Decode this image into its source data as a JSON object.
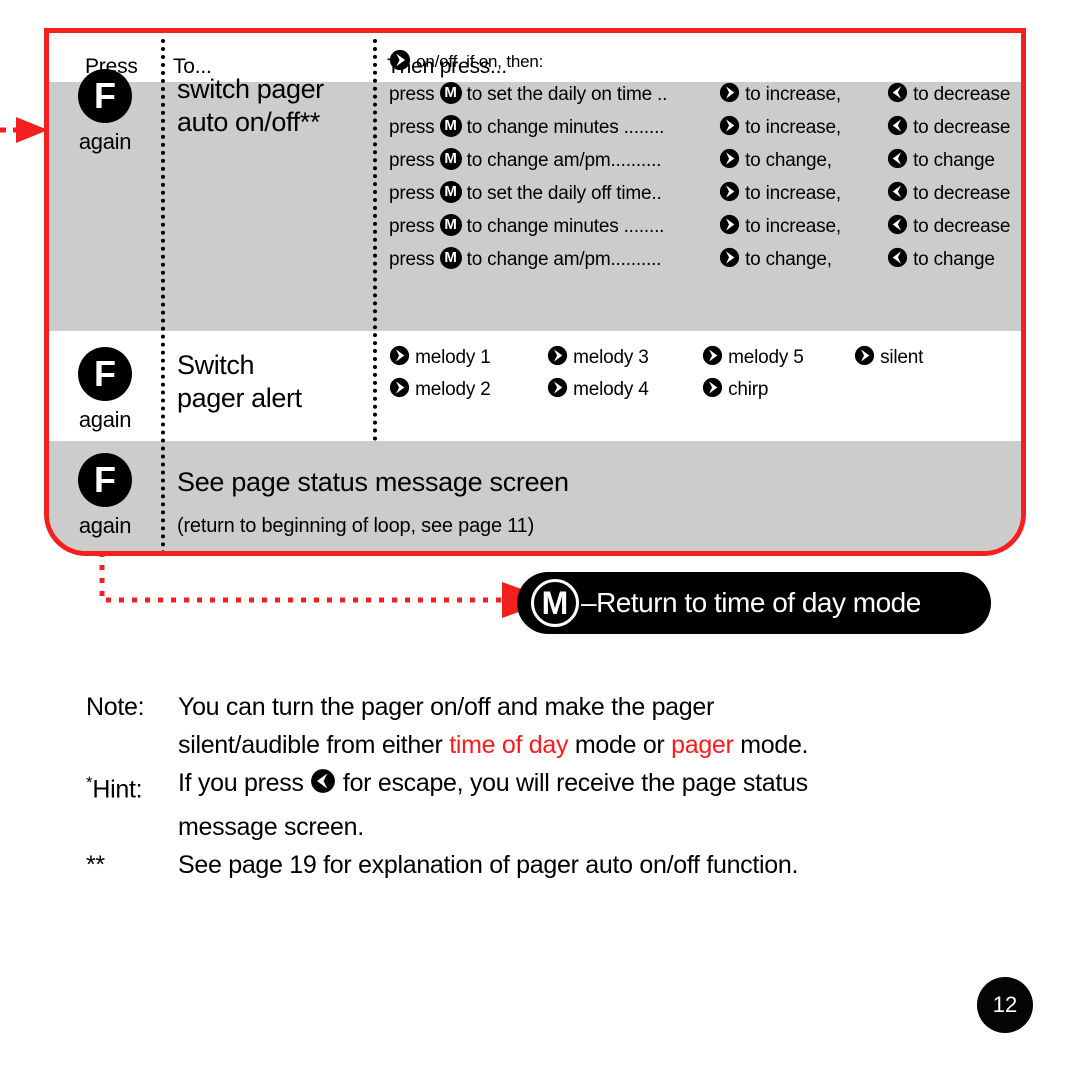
{
  "table": {
    "headers": {
      "press": "Press",
      "to": "To...",
      "then": "Then press..."
    },
    "rows": [
      {
        "press_key": "F",
        "press_sub": "again",
        "to_line1": "switch pager",
        "to_line2": "auto on/off**",
        "then_first": "on/off, if on, then:",
        "then_lines": [
          {
            "press": "press",
            "action": "to set the daily on time ..",
            "inc": "to increase,",
            "dec": "to decrease"
          },
          {
            "press": "press",
            "action": "to change minutes ........",
            "inc": "to increase,",
            "dec": "to decrease"
          },
          {
            "press": "press",
            "action": "to change am/pm..........",
            "inc": "to change,",
            "dec": "to change"
          },
          {
            "press": "press",
            "action": "to set the daily off time..",
            "inc": "to increase,",
            "dec": "to decrease"
          },
          {
            "press": "press",
            "action": "to change minutes ........",
            "inc": "to increase,",
            "dec": "to decrease"
          },
          {
            "press": "press",
            "action": "to change am/pm..........",
            "inc": "to change,",
            "dec": "to change"
          }
        ]
      },
      {
        "press_key": "F",
        "press_sub": "again",
        "to_line1": "Switch",
        "to_line2": "pager alert",
        "melodies": [
          [
            "melody 1",
            "melody 3",
            "melody 5",
            "silent"
          ],
          [
            "melody 2",
            "melody 4",
            "chirp",
            ""
          ]
        ]
      },
      {
        "press_key": "F",
        "press_sub": "again",
        "title": "See page status message screen",
        "subtitle": "(return to beginning of loop, see page 11)"
      }
    ]
  },
  "mode_pill": {
    "key": "M",
    "dash": "–",
    "text": "Return to time of day mode"
  },
  "notes": [
    {
      "label": "Note:",
      "line1": "You can turn the pager on/off and make the pager",
      "line2_a": "silent/audible from either ",
      "line2_red1": "time of day",
      "line2_b": " mode or ",
      "line2_red2": "pager",
      "line2_c": " mode."
    },
    {
      "label_sup": "*",
      "label": "Hint:",
      "line1_a": "If you press ",
      "line1_b": " for escape, you will receive the page status",
      "line2": "message screen."
    },
    {
      "label": "**",
      "line1": "See page 19 for explanation of pager auto on/off function."
    }
  ],
  "page_number": "12",
  "icons": {
    "right_arrow": "right-arrow-circle-icon",
    "left_arrow": "left-arrow-circle-icon",
    "menu_key": "menu-key-icon",
    "function_key": "function-key-icon"
  },
  "colors": {
    "red": "#f51f20",
    "note_red": "#ff1a1a",
    "shade": "#cccccc",
    "black": "#000000"
  }
}
